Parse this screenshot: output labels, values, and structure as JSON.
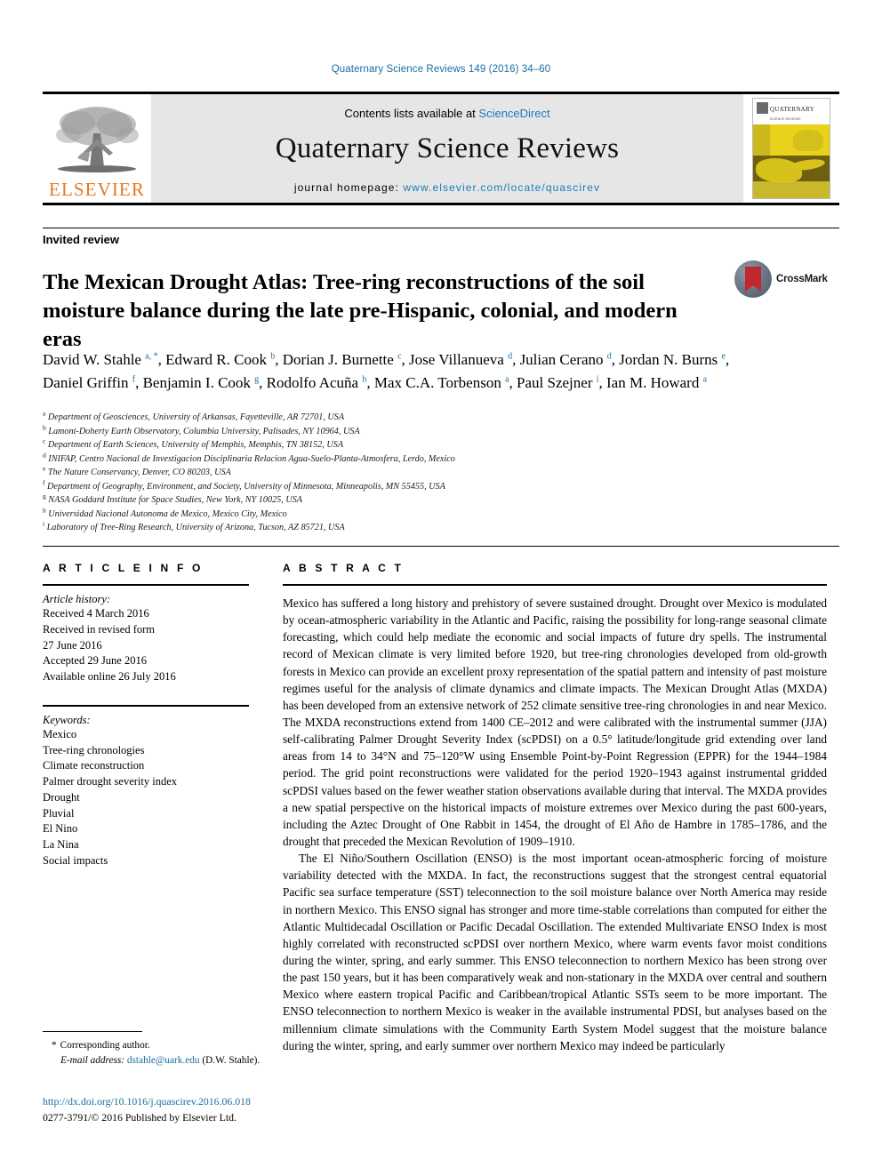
{
  "running_head": "Quaternary Science Reviews 149 (2016) 34–60",
  "masthead": {
    "contents_prefix": "Contents lists available at ",
    "sciencedirect": "ScienceDirect",
    "journal_title": "Quaternary Science Reviews",
    "homepage_label": "journal homepage: ",
    "homepage_url": "www.elsevier.com/locate/quascirev",
    "elsevier_wordmark": "ELSEVIER",
    "cover_title": "QUATERNARY",
    "cover_subtitle": "SCIENCE REVIEWS",
    "accent_blue": "#1a7bb9",
    "elsevier_orange": "#E87722"
  },
  "article": {
    "type_label": "Invited review",
    "title": "The Mexican Drought Atlas: Tree-ring reconstructions of the soil moisture balance during the late pre-Hispanic, colonial, and modern eras",
    "crossmark_label": "CrossMark"
  },
  "authors": [
    {
      "name": "David W. Stahle",
      "marks": "a, *"
    },
    {
      "name": "Edward R. Cook",
      "marks": "b"
    },
    {
      "name": "Dorian J. Burnette",
      "marks": "c"
    },
    {
      "name": "Jose Villanueva",
      "marks": "d"
    },
    {
      "name": "Julian Cerano",
      "marks": "d"
    },
    {
      "name": "Jordan N. Burns",
      "marks": "e"
    },
    {
      "name": "Daniel Griffin",
      "marks": "f"
    },
    {
      "name": "Benjamin I. Cook",
      "marks": "g"
    },
    {
      "name": "Rodolfo Acuña",
      "marks": "h"
    },
    {
      "name": "Max C.A. Torbenson",
      "marks": "a"
    },
    {
      "name": "Paul Szejner",
      "marks": "i"
    },
    {
      "name": "Ian M. Howard",
      "marks": "a"
    }
  ],
  "affiliations": [
    {
      "mark": "a",
      "text": "Department of Geosciences, University of Arkansas, Fayetteville, AR 72701, USA"
    },
    {
      "mark": "b",
      "text": "Lamont-Doherty Earth Observatory, Columbia University, Palisades, NY 10964, USA"
    },
    {
      "mark": "c",
      "text": "Department of Earth Sciences, University of Memphis, Memphis, TN 38152, USA"
    },
    {
      "mark": "d",
      "text": "INIFAP, Centro Nacional de Investigacion Disciplinaria Relacion Agua-Suelo-Planta-Atmosfera, Lerdo, Mexico"
    },
    {
      "mark": "e",
      "text": "The Nature Conservancy, Denver, CO 80203, USA"
    },
    {
      "mark": "f",
      "text": "Department of Geography, Environment, and Society, University of Minnesota, Minneapolis, MN 55455, USA"
    },
    {
      "mark": "g",
      "text": "NASA Goddard Institute for Space Studies, New York, NY 10025, USA"
    },
    {
      "mark": "h",
      "text": "Universidad Nacional Autonoma de Mexico, Mexico City, Mexico"
    },
    {
      "mark": "i",
      "text": "Laboratory of Tree-Ring Research, University of Arizona, Tucson, AZ 85721, USA"
    }
  ],
  "article_info": {
    "heading": "A R T I C L E  I N F O",
    "history_title": "Article history:",
    "history": [
      "Received 4 March 2016",
      "Received in revised form",
      "27 June 2016",
      "Accepted 29 June 2016",
      "Available online 26 July 2016"
    ],
    "keywords_title": "Keywords:",
    "keywords": [
      "Mexico",
      "Tree-ring chronologies",
      "Climate reconstruction",
      "Palmer drought severity index",
      "Drought",
      "Pluvial",
      "El Nino",
      "La Nina",
      "Social impacts"
    ]
  },
  "abstract": {
    "heading": "A B S T R A C T",
    "paragraphs": [
      "Mexico has suffered a long history and prehistory of severe sustained drought. Drought over Mexico is modulated by ocean-atmospheric variability in the Atlantic and Pacific, raising the possibility for long-range seasonal climate forecasting, which could help mediate the economic and social impacts of future dry spells. The instrumental record of Mexican climate is very limited before 1920, but tree-ring chronologies developed from old-growth forests in Mexico can provide an excellent proxy representation of the spatial pattern and intensity of past moisture regimes useful for the analysis of climate dynamics and climate impacts. The Mexican Drought Atlas (MXDA) has been developed from an extensive network of 252 climate sensitive tree-ring chronologies in and near Mexico. The MXDA reconstructions extend from 1400 CE–2012 and were calibrated with the instrumental summer (JJA) self-calibrating Palmer Drought Severity Index (scPDSI) on a 0.5° latitude/longitude grid extending over land areas from 14 to 34°N and 75–120°W using Ensemble Point-by-Point Regression (EPPR) for the 1944–1984 period. The grid point reconstructions were validated for the period 1920–1943 against instrumental gridded scPDSI values based on the fewer weather station observations available during that interval. The MXDA provides a new spatial perspective on the historical impacts of moisture extremes over Mexico during the past 600-years, including the Aztec Drought of One Rabbit in 1454, the drought of El Año de Hambre in 1785–1786, and the drought that preceded the Mexican Revolution of 1909–1910.",
      "The El Niño/Southern Oscillation (ENSO) is the most important ocean-atmospheric forcing of moisture variability detected with the MXDA. In fact, the reconstructions suggest that the strongest central equatorial Pacific sea surface temperature (SST) teleconnection to the soil moisture balance over North America may reside in northern Mexico. This ENSO signal has stronger and more time-stable correlations than computed for either the Atlantic Multidecadal Oscillation or Pacific Decadal Oscillation. The extended Multivariate ENSO Index is most highly correlated with reconstructed scPDSI over northern Mexico, where warm events favor moist conditions during the winter, spring, and early summer. This ENSO teleconnection to northern Mexico has been strong over the past 150 years, but it has been comparatively weak and non-stationary in the MXDA over central and southern Mexico where eastern tropical Pacific and Caribbean/tropical Atlantic SSTs seem to be more important. The ENSO teleconnection to northern Mexico is weaker in the available instrumental PDSI, but analyses based on the millennium climate simulations with the Community Earth System Model suggest that the moisture balance during the winter, spring, and early summer over northern Mexico may indeed be particularly"
    ]
  },
  "footer": {
    "corresponding_marker": "*",
    "corresponding_label": "Corresponding author.",
    "email_label": "E-mail address:",
    "email": "dstahle@uark.edu",
    "email_owner": "(D.W. Stahle).",
    "doi": "http://dx.doi.org/10.1016/j.quascirev.2016.06.018",
    "issn_line": "0277-3791/© 2016 Published by Elsevier Ltd."
  }
}
